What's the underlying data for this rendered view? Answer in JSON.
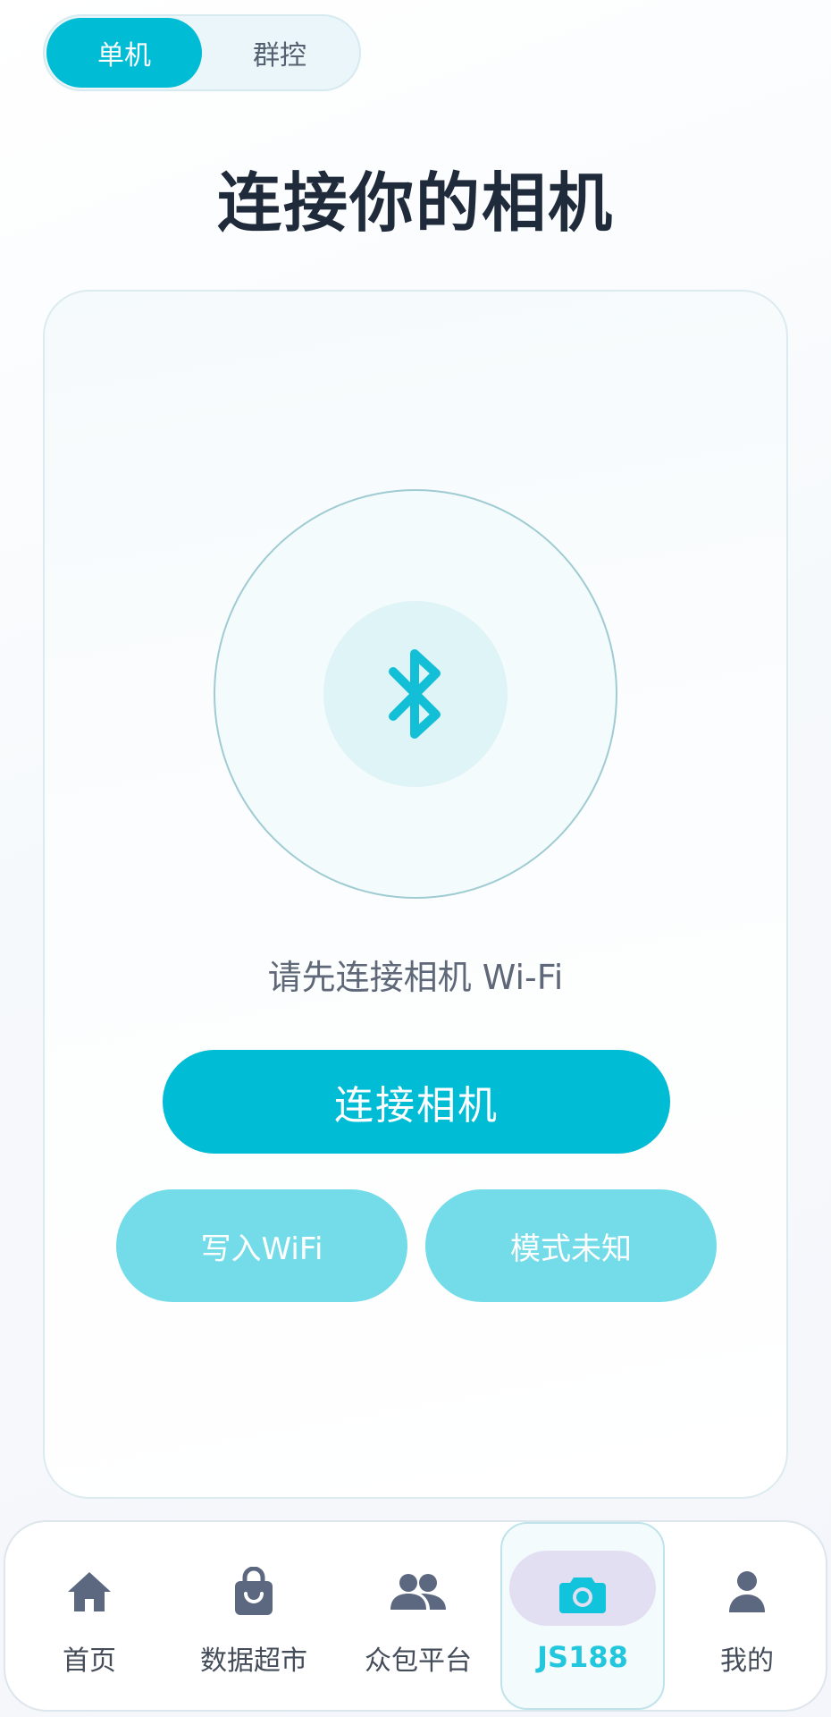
{
  "mode_switch": {
    "single_label": "单机",
    "group_label": "群控",
    "selected": "单机"
  },
  "page": {
    "title": "连接你的相机"
  },
  "connect_card": {
    "status_icon": "bluetooth-icon",
    "hint": "请先连接相机 Wi-Fi",
    "connect_button": "连接相机",
    "write_wifi_button": "写入WiFi",
    "mode_button": "模式未知"
  },
  "bottom_nav": {
    "items": [
      {
        "label": "首页",
        "icon": "home-icon"
      },
      {
        "label": "数据超市",
        "icon": "shopping-bag-icon"
      },
      {
        "label": "众包平台",
        "icon": "people-icon"
      },
      {
        "label": "JS188",
        "icon": "camera-icon"
      },
      {
        "label": "我的",
        "icon": "person-icon"
      }
    ],
    "active_index": 3
  },
  "colors": {
    "accent": "#00bcd4",
    "accent_light": "#74dce8",
    "title": "#1f2a3a",
    "nav_icon": "#5c6880",
    "active_pill": "#e3dff3"
  }
}
